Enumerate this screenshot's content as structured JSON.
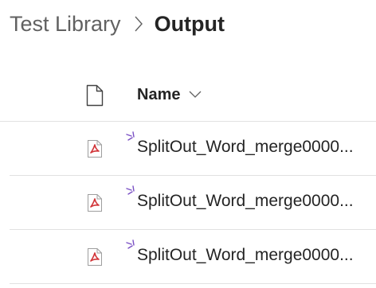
{
  "breadcrumb": {
    "parent": "Test Library",
    "current": "Output"
  },
  "list": {
    "columns": {
      "file_type_icon": "document-icon",
      "name": "Name"
    },
    "items": [
      {
        "name": "SplitOut_Word_merge0000...",
        "type_icon": "pdf-file-icon",
        "new_indicator": "new-item-icon"
      },
      {
        "name": "SplitOut_Word_merge0000...",
        "type_icon": "pdf-file-icon",
        "new_indicator": "new-item-icon"
      },
      {
        "name": "SplitOut_Word_merge0000...",
        "type_icon": "pdf-file-icon",
        "new_indicator": "new-item-icon"
      }
    ]
  },
  "colors": {
    "pdf_red": "#d13438",
    "new_mark_purple": "#7a50c4",
    "divider": "#e1e1e1",
    "muted_text": "#616161"
  }
}
